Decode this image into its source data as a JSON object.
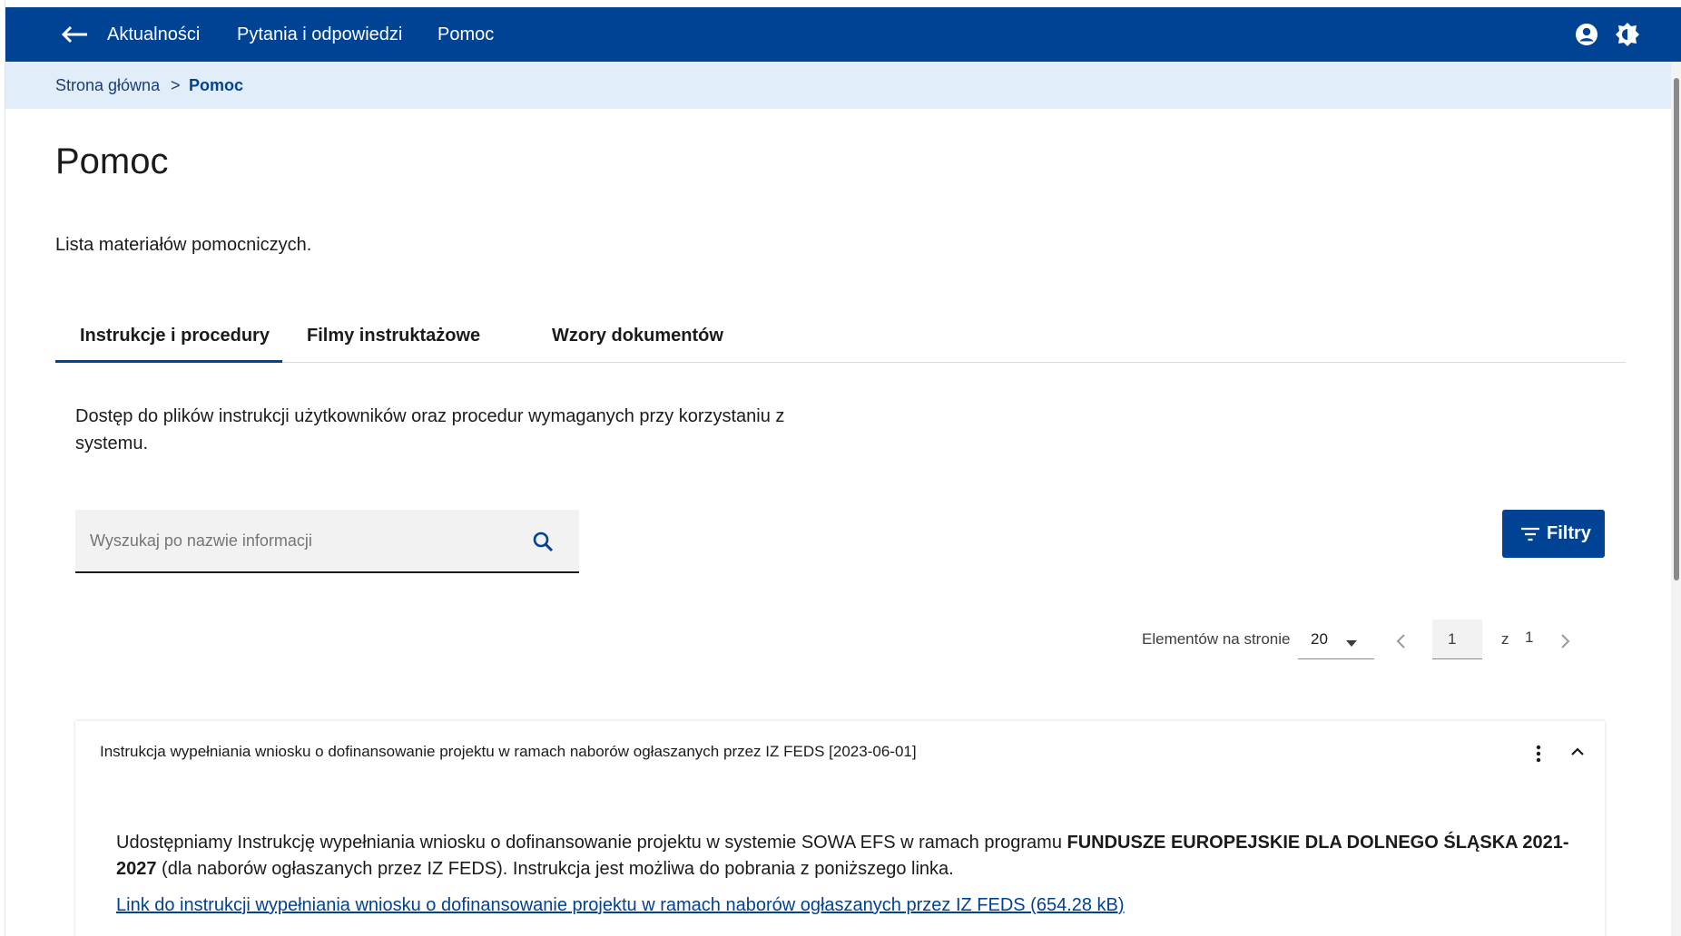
{
  "topbar": {
    "nav": [
      "Aktualności",
      "Pytania i odpowiedzi",
      "Pomoc"
    ],
    "icons": [
      "back-arrow-icon",
      "user-account-icon",
      "contrast-icon"
    ],
    "background_color": "#004293"
  },
  "breadcrumb": {
    "home": "Strona główna",
    "separator": ">",
    "current": "Pomoc"
  },
  "page": {
    "title": "Pomoc",
    "description": "Lista materiałów pomocniczych."
  },
  "tabs": [
    {
      "label": "Instrukcje i procedury",
      "active": true
    },
    {
      "label": "Filmy instruktażowe",
      "active": false
    },
    {
      "label": "Wzory dokumentów",
      "active": false
    }
  ],
  "tab_content": {
    "description": "Dostęp do plików instrukcji użytkowników oraz procedur wymaganych przy korzystaniu z systemu."
  },
  "search": {
    "placeholder": "Wyszukaj po nazwie informacji",
    "value": ""
  },
  "filters_button": {
    "label": "Filtry"
  },
  "paginator": {
    "per_page_label": "Elementów na stronie",
    "per_page_value": "20",
    "current_page": "1",
    "of_label": "z",
    "total_pages": "1"
  },
  "item": {
    "title": "Instrukcja wypełniania wniosku o dofinansowanie projektu w ramach naborów ogłaszanych przez IZ FEDS [2023-06-01]",
    "body_part1": "Udostępniamy Instrukcję wypełniania wniosku o dofinansowanie projektu w systemie SOWA EFS w ramach programu ",
    "body_bold": "FUNDUSZE EUROPEJSKIE DLA DOLNEGO ŚLĄSKA 2021-2027",
    "body_part2": " (dla naborów ogłaszanych przez IZ FEDS). Instrukcja jest możliwa do pobrania z poniższego linka.",
    "link": "Link do instrukcji wypełniania wniosku o dofinansowanie projektu w ramach naborów ogłaszanych przez IZ FEDS (654.28 kB)",
    "expanded": true
  },
  "colors": {
    "primary": "#004293",
    "breadcrumb_bg": "#e1eef9",
    "input_bg": "#f2f2f2"
  }
}
